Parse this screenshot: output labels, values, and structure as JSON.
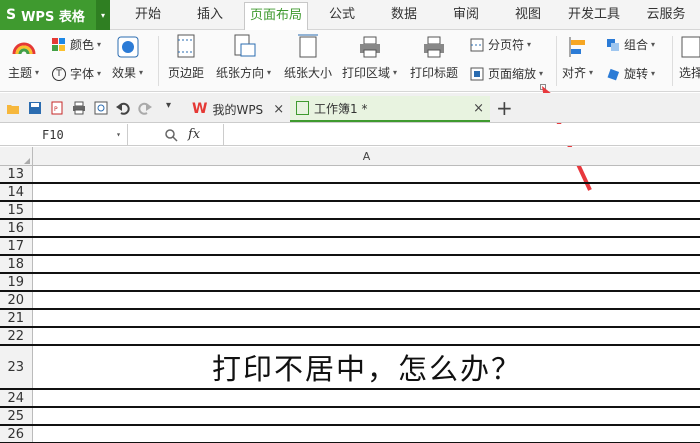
{
  "app": {
    "name": "WPS 表格",
    "logo": "S"
  },
  "menu": {
    "tabs": [
      "开始",
      "插入",
      "页面布局",
      "公式",
      "数据",
      "审阅",
      "视图",
      "开发工具",
      "云服务"
    ],
    "active": "页面布局"
  },
  "ribbon": {
    "theme": "主题",
    "colors": "颜色",
    "fonts": "字体",
    "effects": "效果",
    "margins": "页边距",
    "orientation": "纸张方向",
    "size": "纸张大小",
    "print_area": "打印区域",
    "print_titles": "打印标题",
    "page_break": "分页符",
    "page_scale": "页面缩放",
    "align": "对齐",
    "group": "组合",
    "rotate": "旋转",
    "select": "选择"
  },
  "doc_tabs": [
    {
      "label": "我的WPS"
    },
    {
      "label": "工作簿1 *"
    }
  ],
  "formula_bar": {
    "name_box": "F10",
    "fx": "fx"
  },
  "grid": {
    "column": "A",
    "rows": [
      {
        "num": "13",
        "text": ""
      },
      {
        "num": "14",
        "text": ""
      },
      {
        "num": "15",
        "text": ""
      },
      {
        "num": "16",
        "text": ""
      },
      {
        "num": "17",
        "text": ""
      },
      {
        "num": "18",
        "text": ""
      },
      {
        "num": "19",
        "text": ""
      },
      {
        "num": "20",
        "text": ""
      },
      {
        "num": "21",
        "text": ""
      },
      {
        "num": "22",
        "text": ""
      },
      {
        "num": "23",
        "text": "打印不居中，怎么办？"
      },
      {
        "num": "24",
        "text": ""
      },
      {
        "num": "25",
        "text": ""
      },
      {
        "num": "26",
        "text": ""
      }
    ]
  },
  "colors": {
    "accent": "#3f9a2f",
    "arrow": "#e8383d"
  }
}
